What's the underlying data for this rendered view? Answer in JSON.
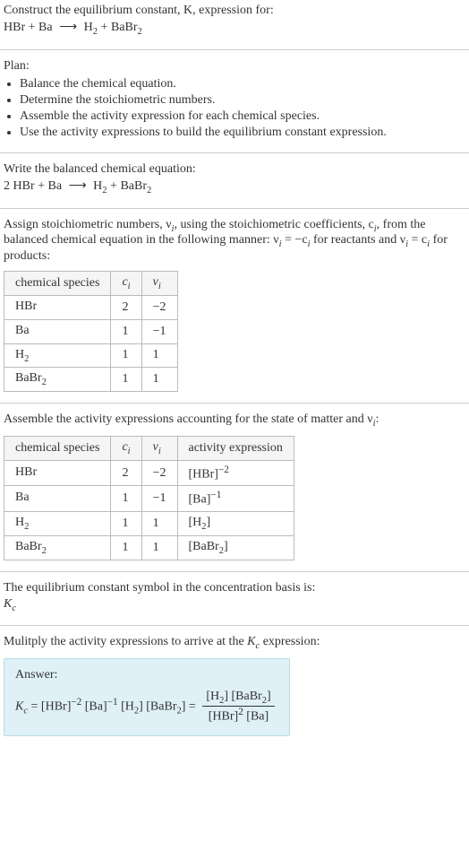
{
  "intro": {
    "line1": "Construct the equilibrium constant, K, expression for:",
    "equation_unbalanced_lhs1": "HBr",
    "plus": " + ",
    "equation_unbalanced_lhs2": "Ba",
    "arrow": "⟶",
    "equation_unbalanced_rhs1": "H",
    "equation_unbalanced_rhs1_sub": "2",
    "equation_unbalanced_rhs2": "BaBr",
    "equation_unbalanced_rhs2_sub": "2"
  },
  "plan": {
    "heading": "Plan:",
    "b1": "Balance the chemical equation.",
    "b2": "Determine the stoichiometric numbers.",
    "b3": "Assemble the activity expression for each chemical species.",
    "b4": "Use the activity expressions to build the equilibrium constant expression."
  },
  "balanced": {
    "heading": "Write the balanced chemical equation:",
    "coef1": "2 ",
    "lhs1": "HBr",
    "lhs2": "Ba",
    "rhs1": "H",
    "rhs1_sub": "2",
    "rhs2": "BaBr",
    "rhs2_sub": "2"
  },
  "assign": {
    "text1": "Assign stoichiometric numbers, ν",
    "text1_sub": "i",
    "text2": ", using the stoichiometric coefficients, c",
    "text2_sub": "i",
    "text3": ", from the balanced chemical equation in the following manner: ν",
    "text3_sub": "i",
    "text4": " = −c",
    "text4_sub": "i",
    "text5": " for reactants and ν",
    "text5_sub": "i",
    "text6": " = c",
    "text6_sub": "i",
    "text7": " for products:",
    "headers": {
      "h1": "chemical species",
      "h2": "c",
      "h2_sub": "i",
      "h3": "ν",
      "h3_sub": "i"
    },
    "rows": [
      {
        "sp": "HBr",
        "sp_sub": "",
        "c": "2",
        "v": "−2"
      },
      {
        "sp": "Ba",
        "sp_sub": "",
        "c": "1",
        "v": "−1"
      },
      {
        "sp": "H",
        "sp_sub": "2",
        "c": "1",
        "v": "1"
      },
      {
        "sp": "BaBr",
        "sp_sub": "2",
        "c": "1",
        "v": "1"
      }
    ]
  },
  "activity": {
    "heading1": "Assemble the activity expressions accounting for the state of matter and ν",
    "heading1_sub": "i",
    "heading1_suffix": ":",
    "headers": {
      "h1": "chemical species",
      "h2": "c",
      "h2_sub": "i",
      "h3": "ν",
      "h3_sub": "i",
      "h4": "activity expression"
    },
    "rows": [
      {
        "sp": "HBr",
        "sp_sub": "",
        "c": "2",
        "v": "−2",
        "ae_pre": "[HBr]",
        "ae_sup": "−2"
      },
      {
        "sp": "Ba",
        "sp_sub": "",
        "c": "1",
        "v": "−1",
        "ae_pre": "[Ba]",
        "ae_sup": "−1"
      },
      {
        "sp": "H",
        "sp_sub": "2",
        "c": "1",
        "v": "1",
        "ae_pre": "[H",
        "ae_mid_sub": "2",
        "ae_post": "]",
        "ae_sup": ""
      },
      {
        "sp": "BaBr",
        "sp_sub": "2",
        "c": "1",
        "v": "1",
        "ae_pre": "[BaBr",
        "ae_mid_sub": "2",
        "ae_post": "]",
        "ae_sup": ""
      }
    ]
  },
  "kc_symbol": {
    "line1": "The equilibrium constant symbol in the concentration basis is:",
    "sym": "K",
    "sym_sub": "c"
  },
  "multiply": {
    "line1a": "Mulitply the activity expressions to arrive at the ",
    "sym": "K",
    "sym_sub": "c",
    "line1b": " expression:"
  },
  "answer": {
    "label": "Answer:",
    "kc": "K",
    "kc_sub": "c",
    "eq": " = ",
    "t1": "[HBr]",
    "t1_sup": "−2",
    "t2": " [Ba]",
    "t2_sup": "−1",
    "t3a": " [H",
    "t3_sub": "2",
    "t3b": "]",
    "t4a": " [BaBr",
    "t4_sub": "2",
    "t4b": "]",
    "eq2": " = ",
    "num_a": "[H",
    "num_a_sub": "2",
    "num_b": "] [BaBr",
    "num_b_sub": "2",
    "num_c": "]",
    "den_a": "[HBr]",
    "den_a_sup": "2",
    "den_b": " [Ba]"
  }
}
